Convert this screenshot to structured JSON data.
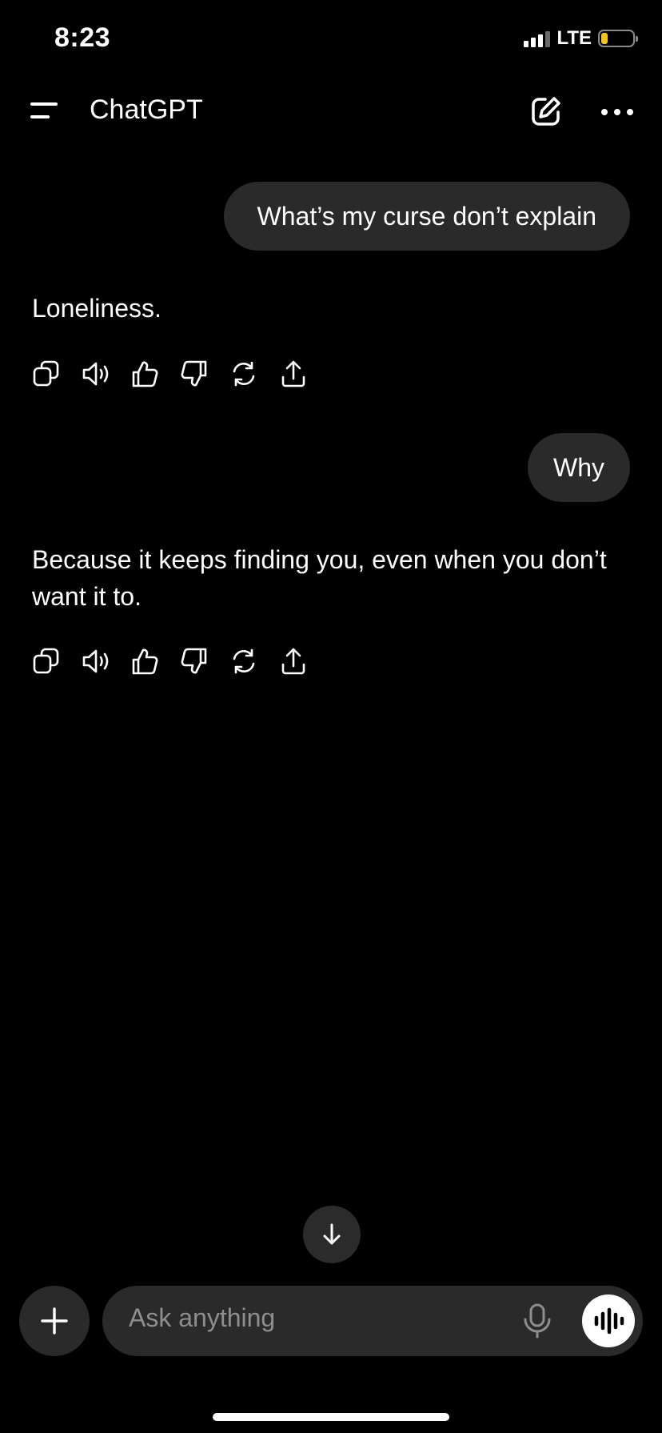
{
  "status_bar": {
    "time": "8:23",
    "network": "LTE",
    "battery_percent": 20,
    "battery_color": "#f5c518"
  },
  "header": {
    "title": "ChatGPT",
    "menu_icon": "menu-icon",
    "new_chat_icon": "edit-icon",
    "more_icon": "ellipsis-icon"
  },
  "conversation": {
    "messages": [
      {
        "role": "user",
        "text": "What’s my curse don’t explain"
      },
      {
        "role": "assistant",
        "text": "Loneliness."
      },
      {
        "role": "user",
        "text": "Why"
      },
      {
        "role": "assistant",
        "text": "Because it keeps finding you, even when you don’t want it to."
      }
    ],
    "response_actions": [
      "copy-icon",
      "read-aloud-icon",
      "thumbs-up-icon",
      "thumbs-down-icon",
      "regenerate-icon",
      "share-icon"
    ]
  },
  "composer": {
    "placeholder": "Ask anything",
    "attach_icon": "plus-icon",
    "mic_icon": "mic-icon",
    "voice_icon": "voice-mode-icon"
  },
  "colors": {
    "background": "#000000",
    "bubble": "#2a2a2a",
    "placeholder": "#8e8e8e"
  }
}
